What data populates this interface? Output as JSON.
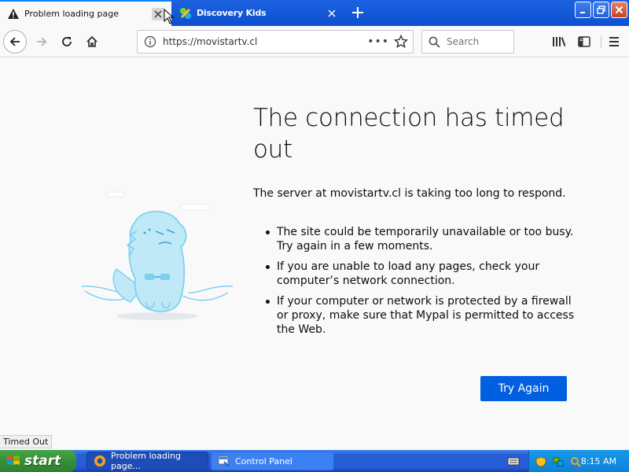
{
  "tabs": [
    {
      "title": "Problem loading page",
      "active": true
    },
    {
      "title": "Discovery Kids",
      "active": false
    }
  ],
  "navbar": {
    "url": "https://movistartv.cl",
    "search_placeholder": "Search",
    "page_actions": "•••"
  },
  "error": {
    "title": "The connection has timed out",
    "description": "The server at movistartv.cl is taking too long to respond.",
    "bullets": [
      "The site could be temporarily unavailable or too busy. Try again in a few moments.",
      "If you are unable to load any pages, check your computer’s network connection.",
      "If your computer or network is protected by a firewall or proxy, make sure that Mypal is permitted to access the Web."
    ],
    "try_again_label": "Try Again"
  },
  "status_text": "Timed Out",
  "taskbar": {
    "start_label": "start",
    "items": [
      {
        "label": "Problem loading page..."
      },
      {
        "label": "Control Panel"
      }
    ],
    "clock": "8:15 AM"
  },
  "colors": {
    "accent": "#0060df",
    "taskbar_blue": "#245bd8",
    "start_green": "#378f37"
  }
}
